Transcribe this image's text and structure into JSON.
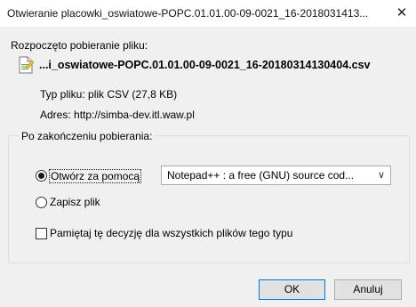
{
  "window": {
    "title": "Otwieranie placowki_oswiatowe-POPC.01.01.00-09-0021_16-2018031413...",
    "close_glyph": "✕"
  },
  "download": {
    "heading": "Rozpoczęto pobieranie pliku:",
    "file_icon": "csv-file-icon",
    "filename": "...i_oswiatowe-POPC.01.01.00-09-0021_16-20180314130404.csv",
    "type_label": "Typ pliku:",
    "type_value": "plik CSV (27,8 KB)",
    "address_label": "Adres:",
    "address_value": "http://simba-dev.itl.waw.pl"
  },
  "after_download": {
    "legend": "Po zakończeniu pobierania:",
    "open_with_label": "Otwórz za pomocą",
    "open_with_selected": true,
    "app_select_value": "Notepad++ : a free (GNU) source cod...",
    "save_label": "Zapisz plik",
    "save_selected": false,
    "remember_label": "Pamiętaj tę decyzję dla wszystkich plików tego typu",
    "remember_checked": false
  },
  "buttons": {
    "ok": "OK",
    "cancel": "Anuluj"
  }
}
